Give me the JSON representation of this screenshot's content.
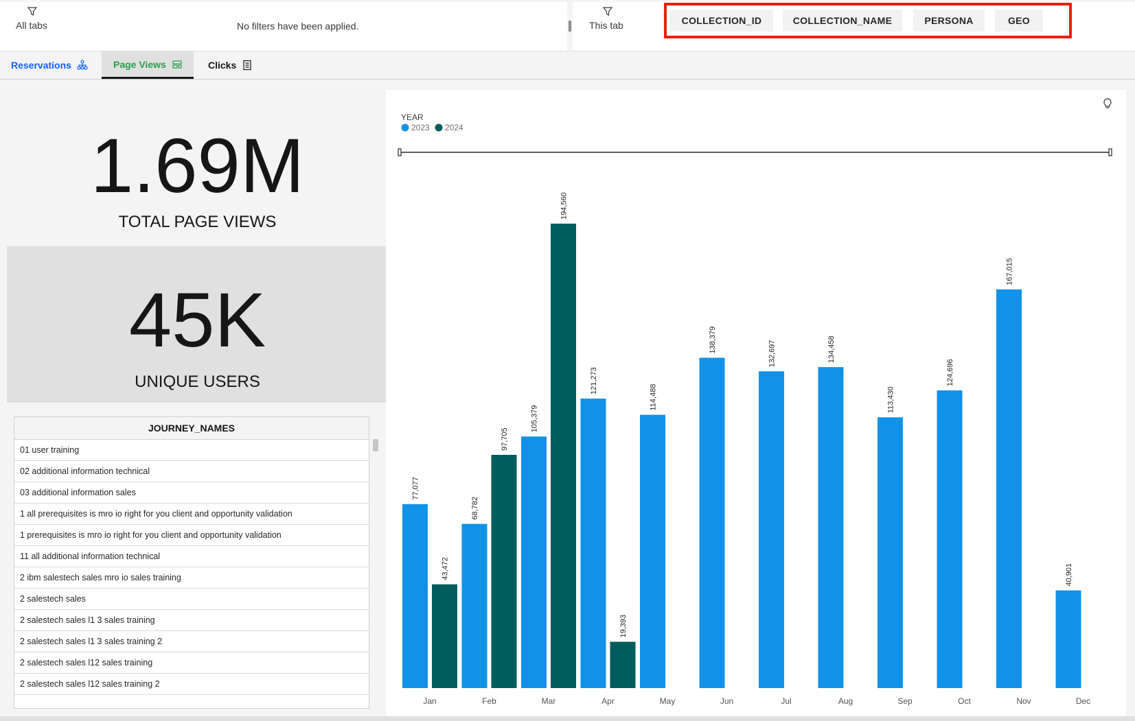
{
  "filters": {
    "all_tabs_label": "All tabs",
    "no_filters_text": "No filters have been applied.",
    "this_tab_label": "This tab",
    "fields": [
      "COLLECTION_ID",
      "COLLECTION_NAME",
      "PERSONA",
      "GEO"
    ]
  },
  "tabs": [
    {
      "label": "Reservations",
      "icon": "org-chart-icon"
    },
    {
      "label": "Page Views",
      "icon": "dashboard-icon"
    },
    {
      "label": "Clicks",
      "icon": "report-icon"
    }
  ],
  "kpis": {
    "page_views": {
      "value": "1.69M",
      "label": "TOTAL PAGE VIEWS"
    },
    "unique_users": {
      "value": "45K",
      "label": "UNIQUE USERS"
    }
  },
  "journey_table": {
    "header": "JOURNEY_NAMES",
    "rows": [
      "01 user training",
      "02 additional information technical",
      "03 additional information sales",
      "1 all prerequisites is mro io right for you client and opportunity validation",
      "1 prerequisites is mro io right for you client and opportunity validation",
      "11 all additional information technical",
      "2 ibm salestech sales mro io sales training",
      "2 salestech sales",
      "2 salestech sales l1 3 sales training",
      "2 salestech sales l1 3 sales training 2",
      "2 salestech sales l12 sales training",
      "2 salestech sales l12 sales training 2"
    ]
  },
  "colors": {
    "series_2023": "#1192e8",
    "series_2024": "#005d5d",
    "highlight": "#e8200a",
    "active_tab": "#24a148",
    "link_tab": "#0f62fe"
  },
  "chart_data": {
    "type": "bar",
    "legend_title": "YEAR",
    "legend_position": "top-left",
    "categories": [
      "Jan",
      "Feb",
      "Mar",
      "Apr",
      "May",
      "Jun",
      "Jul",
      "Aug",
      "Sep",
      "Oct",
      "Nov",
      "Dec"
    ],
    "series": [
      {
        "name": "2023",
        "values": [
          77077,
          68782,
          105379,
          121273,
          114488,
          138379,
          132697,
          134458,
          113430,
          124696,
          167015,
          40901
        ]
      },
      {
        "name": "2024",
        "values": [
          43472,
          97705,
          194560,
          19393,
          null,
          null,
          null,
          null,
          null,
          null,
          null,
          null
        ]
      }
    ],
    "value_labels": [
      [
        "77,077",
        "68,782",
        "105,379",
        "121,273",
        "114,488",
        "138,379",
        "132,697",
        "134,458",
        "113,430",
        "124,696",
        "167,015",
        "40,901"
      ],
      [
        "43,472",
        "97,705",
        "194,560",
        "19,393",
        null,
        null,
        null,
        null,
        null,
        null,
        null,
        null
      ]
    ],
    "ylim": [
      0,
      194560
    ],
    "grid": false
  }
}
